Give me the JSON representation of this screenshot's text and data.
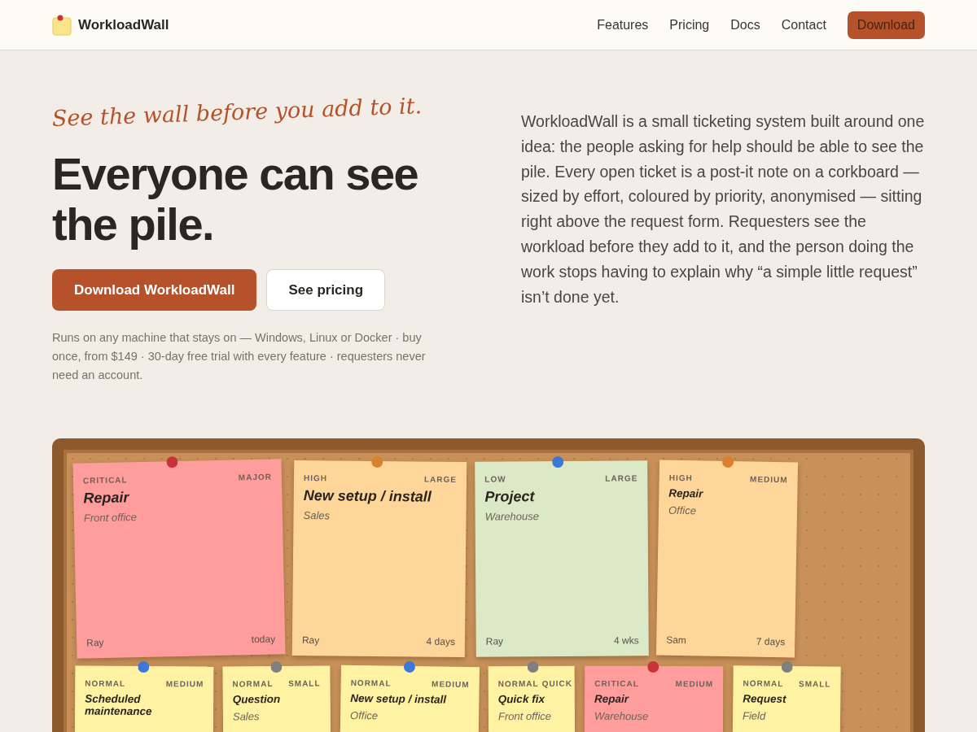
{
  "nav": {
    "brand": "WorkloadWall",
    "links": [
      "Features",
      "Pricing",
      "Docs",
      "Contact"
    ],
    "cta": "Download"
  },
  "hero": {
    "tagline": "See the wall before you add to it.",
    "heading": "Everyone can see the pile.",
    "primary_button": "Download WorkloadWall",
    "secondary_button": "See pricing",
    "fine_print": "Runs on any machine that stays on — Windows, Linux or Docker · buy once, from $149 · 30-day free trial with every feature · requesters never need an account.",
    "description": "WorkloadWall is a small ticketing system built around one idea: the people asking for help should be able to see the pile. Every open ticket is a post-it note on a corkboard — sized by effort, coloured by priority, anonymised — sitting right above the request form. Requesters see the workload before they add to it, and the person doing the work stops having to explain why “a simple little request” isn’t done yet."
  },
  "board": {
    "notes": [
      {
        "priority": "CRITICAL",
        "size": "MAJOR",
        "title": "Repair",
        "location": "Front office",
        "requester": "Ray",
        "age": "today",
        "color": "#c8323a"
      },
      {
        "priority": "HIGH",
        "size": "LARGE",
        "title": "New setup / install",
        "location": "Sales",
        "requester": "Ray",
        "age": "4 days",
        "color": "#d9822b"
      },
      {
        "priority": "LOW",
        "size": "LARGE",
        "title": "Project",
        "location": "Warehouse",
        "requester": "Ray",
        "age": "4 wks",
        "color": "#3b78d8"
      },
      {
        "priority": "HIGH",
        "size": "MEDIUM",
        "title": "Repair",
        "location": "Office",
        "requester": "Sam",
        "age": "7 days",
        "color": "#d9822b"
      },
      {
        "priority": "NORMAL",
        "size": "MEDIUM",
        "title": "Scheduled maintenance",
        "color": "#3b78d8"
      },
      {
        "priority": "NORMAL",
        "size": "SMALL",
        "title": "Question",
        "location": "Sales",
        "color": "#808080"
      },
      {
        "priority": "NORMAL",
        "size": "MEDIUM",
        "title": "New setup / install",
        "location": "Office",
        "color": "#3b78d8"
      },
      {
        "priority": "NORMAL",
        "size": "QUICK",
        "title": "Quick fix",
        "location": "Front office",
        "color": "#808080"
      },
      {
        "priority": "CRITICAL",
        "size": "MEDIUM",
        "title": "Repair",
        "location": "Warehouse",
        "color": "#c8323a"
      },
      {
        "priority": "NORMAL",
        "size": "SMALL",
        "title": "Request",
        "location": "Field",
        "color": "#808080"
      }
    ]
  }
}
